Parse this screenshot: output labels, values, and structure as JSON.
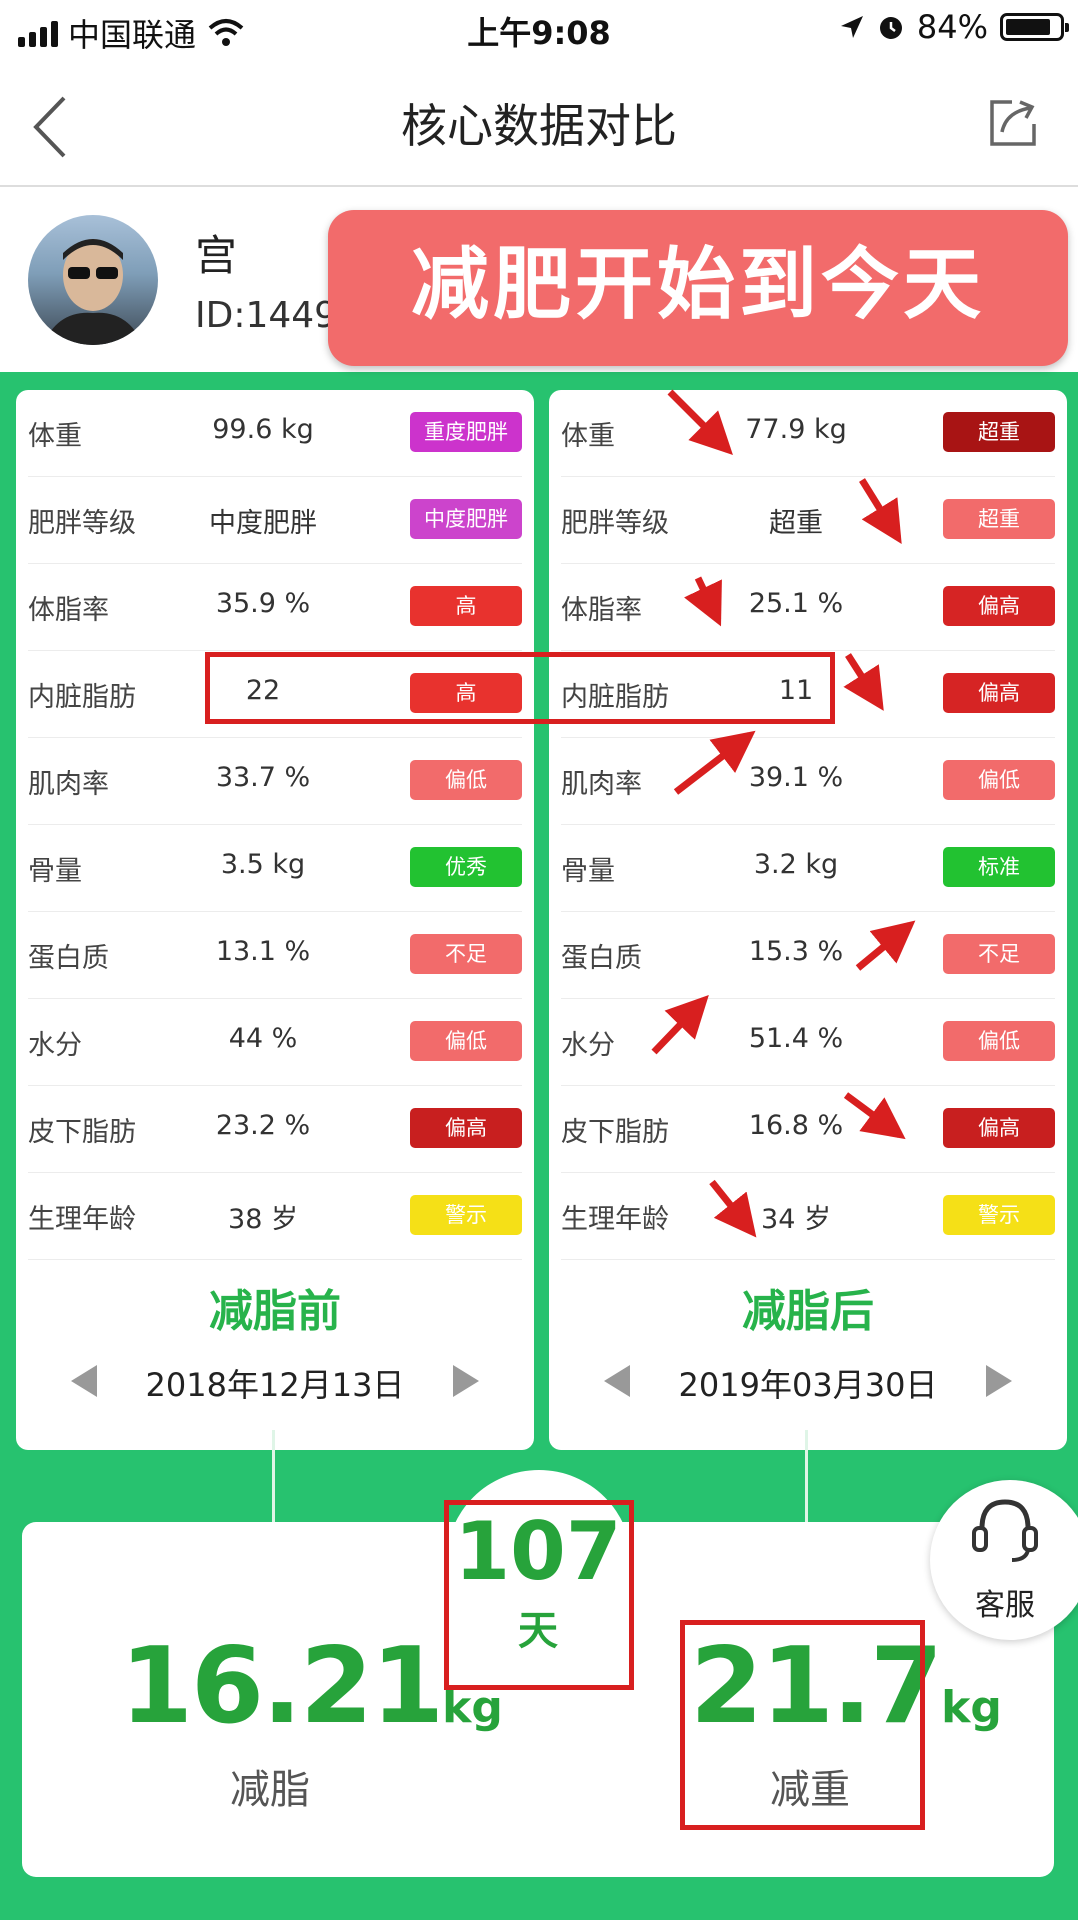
{
  "statusbar": {
    "carrier": "中国联通",
    "time": "上午9:08",
    "battery": "84%"
  },
  "nav": {
    "title": "核心数据对比"
  },
  "profile": {
    "name": "宫",
    "id": "ID:14497"
  },
  "banner": "减肥开始到今天",
  "before": {
    "phase": "减脂前",
    "date": "2018年12月13日",
    "rows": [
      {
        "label": "体重",
        "value": "99.6 kg",
        "badge": "重度肥胖",
        "color": "#cc33cc"
      },
      {
        "label": "肥胖等级",
        "value": "中度肥胖",
        "badge": "中度肥胖",
        "color": "#cc44cc"
      },
      {
        "label": "体脂率",
        "value": "35.9 %",
        "badge": "高",
        "color": "#e8322e"
      },
      {
        "label": "内脏脂肪",
        "value": "22",
        "badge": "高",
        "color": "#e8322e"
      },
      {
        "label": "肌肉率",
        "value": "33.7 %",
        "badge": "偏低",
        "color": "#f26b6b"
      },
      {
        "label": "骨量",
        "value": "3.5 kg",
        "badge": "优秀",
        "color": "#22c231"
      },
      {
        "label": "蛋白质",
        "value": "13.1 %",
        "badge": "不足",
        "color": "#f26b6b"
      },
      {
        "label": "水分",
        "value": "44 %",
        "badge": "偏低",
        "color": "#f26b6b"
      },
      {
        "label": "皮下脂肪",
        "value": "23.2 %",
        "badge": "偏高",
        "color": "#c81f1f"
      },
      {
        "label": "生理年龄",
        "value": "38 岁",
        "badge": "警示",
        "color": "#f5e017"
      }
    ]
  },
  "after": {
    "phase": "减脂后",
    "date": "2019年03月30日",
    "rows": [
      {
        "label": "体重",
        "value": "77.9 kg",
        "badge": "超重",
        "color": "#a81414"
      },
      {
        "label": "肥胖等级",
        "value": "超重",
        "badge": "超重",
        "color": "#f26b6b"
      },
      {
        "label": "体脂率",
        "value": "25.1 %",
        "badge": "偏高",
        "color": "#d62424"
      },
      {
        "label": "内脏脂肪",
        "value": "11",
        "badge": "偏高",
        "color": "#d62424"
      },
      {
        "label": "肌肉率",
        "value": "39.1 %",
        "badge": "偏低",
        "color": "#f26b6b"
      },
      {
        "label": "骨量",
        "value": "3.2 kg",
        "badge": "标准",
        "color": "#22c231"
      },
      {
        "label": "蛋白质",
        "value": "15.3 %",
        "badge": "不足",
        "color": "#f26b6b"
      },
      {
        "label": "水分",
        "value": "51.4 %",
        "badge": "偏低",
        "color": "#f26b6b"
      },
      {
        "label": "皮下脂肪",
        "value": "16.8 %",
        "badge": "偏高",
        "color": "#c81f1f"
      },
      {
        "label": "生理年龄",
        "value": "34 岁",
        "badge": "警示",
        "color": "#f5e017"
      }
    ]
  },
  "summary": {
    "days_num": "107",
    "days_unit": "天",
    "fat_num": "16.21",
    "fat_unit": "kg",
    "fat_label": "减脂",
    "weight_num": "21.7",
    "weight_unit": "kg",
    "weight_label": "减重"
  },
  "kefu": {
    "label": "客服"
  },
  "colors": {
    "green_bg": "#27c26f",
    "accent_green": "#27a33b",
    "annotation_red": "#d81f1f"
  }
}
